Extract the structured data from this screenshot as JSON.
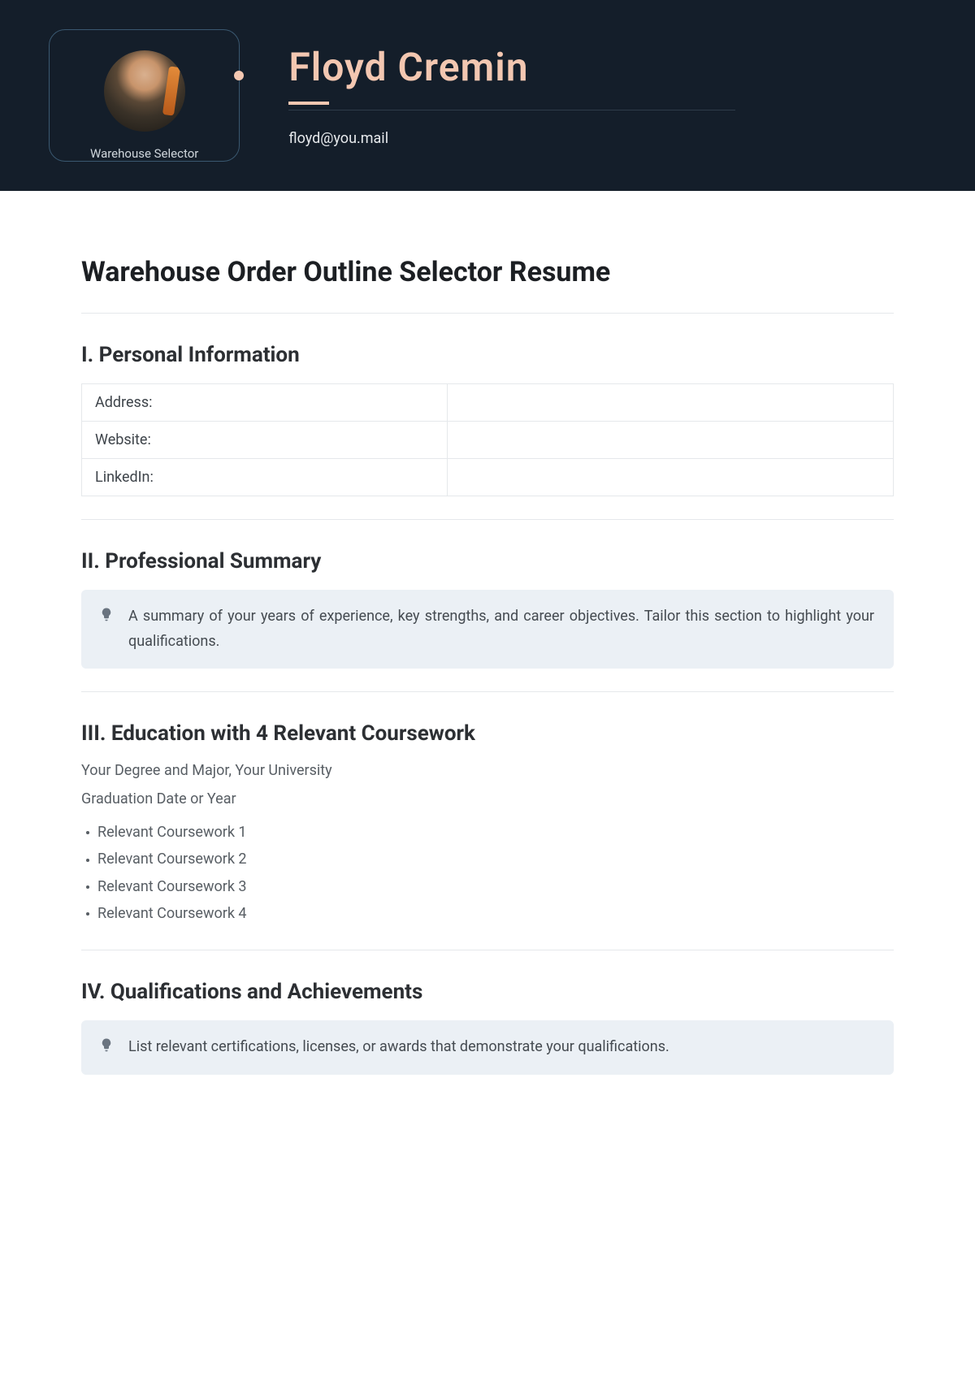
{
  "header": {
    "role": "Warehouse Selector",
    "name": "Floyd Cremin",
    "email": "floyd@you.mail"
  },
  "title": "Warehouse Order Outline Selector Resume",
  "sections": {
    "personal": {
      "heading": "I. Personal Information",
      "rows": [
        "Address:",
        "Website:",
        "LinkedIn:"
      ]
    },
    "summary": {
      "heading": "II. Professional Summary",
      "text": "A summary of your years of experience, key strengths, and career objectives. Tailor this section to highlight your qualifications."
    },
    "education": {
      "heading": "III. Education with 4 Relevant Coursework",
      "degree": "Your Degree and Major, Your University",
      "grad": "Graduation Date or Year",
      "courses": [
        "Relevant Coursework 1",
        "Relevant Coursework 2",
        "Relevant Coursework 3",
        "Relevant Coursework 4"
      ]
    },
    "qualifications": {
      "heading": "IV. Qualifications and Achievements",
      "text": "List relevant certifications, licenses, or awards that demonstrate your qualifications."
    }
  }
}
